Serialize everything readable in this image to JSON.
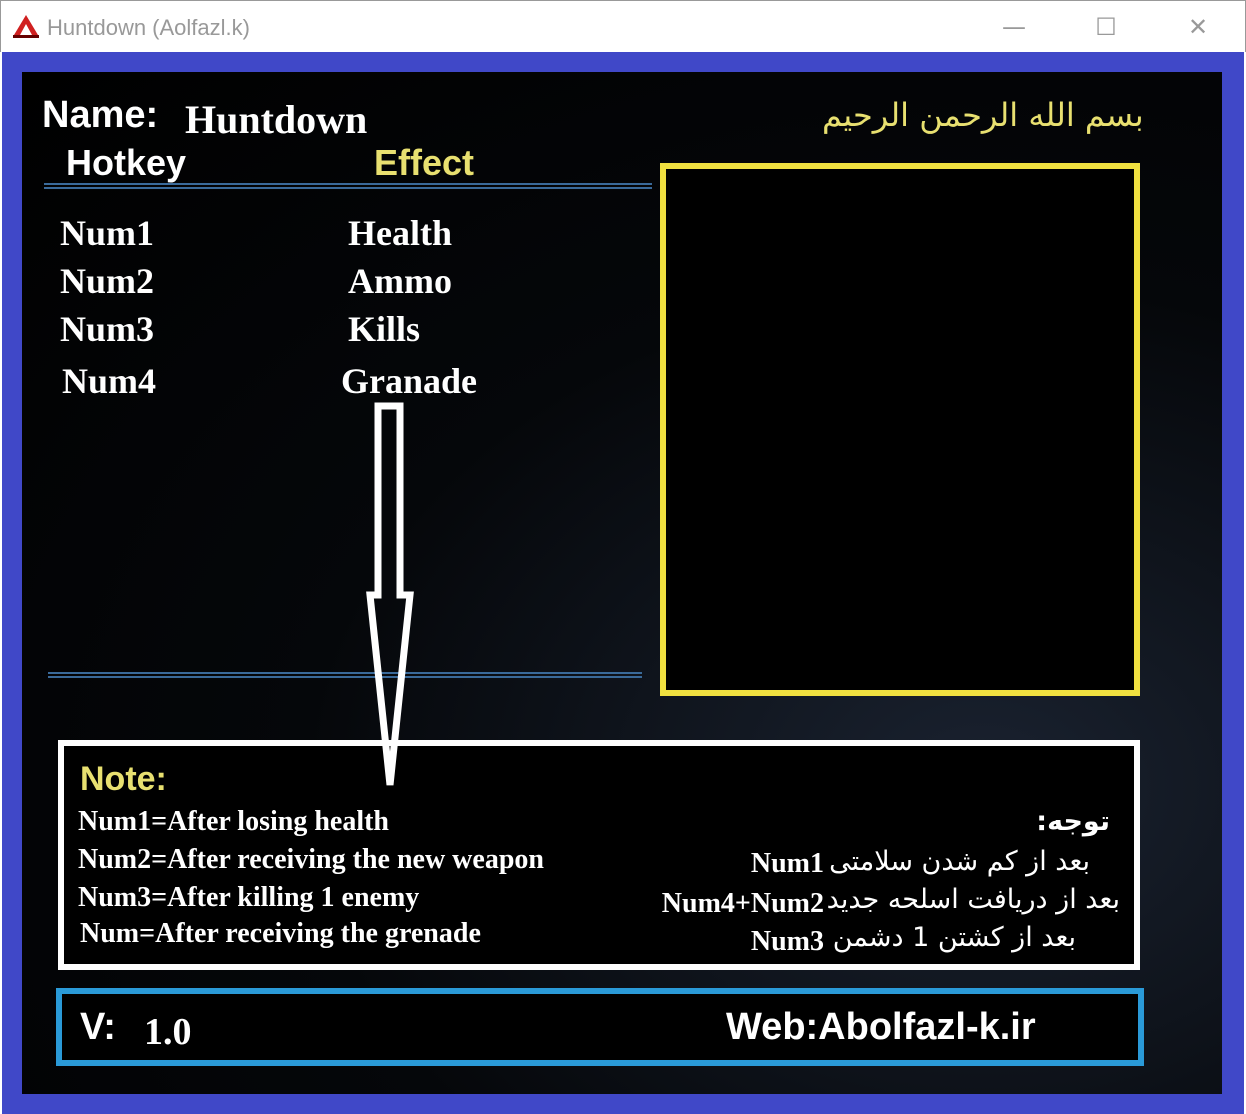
{
  "window": {
    "title": "Huntdown (Aolfazl.k)",
    "minimize": "—",
    "maximize": "☐",
    "close": "✕"
  },
  "header": {
    "name_label": "Name:",
    "name_value": "Huntdown",
    "bismillah": "بسم الله الرحمن الرحيم"
  },
  "table": {
    "col_hotkey": "Hotkey",
    "col_effect": "Effect",
    "rows": [
      {
        "key": "Num1",
        "effect": "Health"
      },
      {
        "key": "Num2",
        "effect": "Ammo"
      },
      {
        "key": "Num3",
        "effect": "Kills"
      },
      {
        "key": "Num4",
        "effect": "Granade"
      }
    ]
  },
  "note": {
    "label": "Note:",
    "lines": [
      "Num1=After losing health",
      "Num2=After receiving the new weapon",
      "Num3=After killing 1 enemy",
      "Num=After receiving the grenade"
    ],
    "fa_label": "توجه:",
    "fa_rows": [
      {
        "key": "Num1",
        "text": "بعد از کم شدن سلامتی"
      },
      {
        "key": "Num4+Num2",
        "text": "بعد از دریافت اسلحه جدید"
      },
      {
        "key": "Num3",
        "text": "بعد از کشتن 1 دشمن"
      }
    ]
  },
  "footer": {
    "version_label": "V:",
    "version": "1.0",
    "web": "Web:Abolfazl-k.ir"
  },
  "colors": {
    "frame": "#4048c8",
    "accent_yellow": "#f0e040",
    "footer_border": "#2a9ad8"
  }
}
